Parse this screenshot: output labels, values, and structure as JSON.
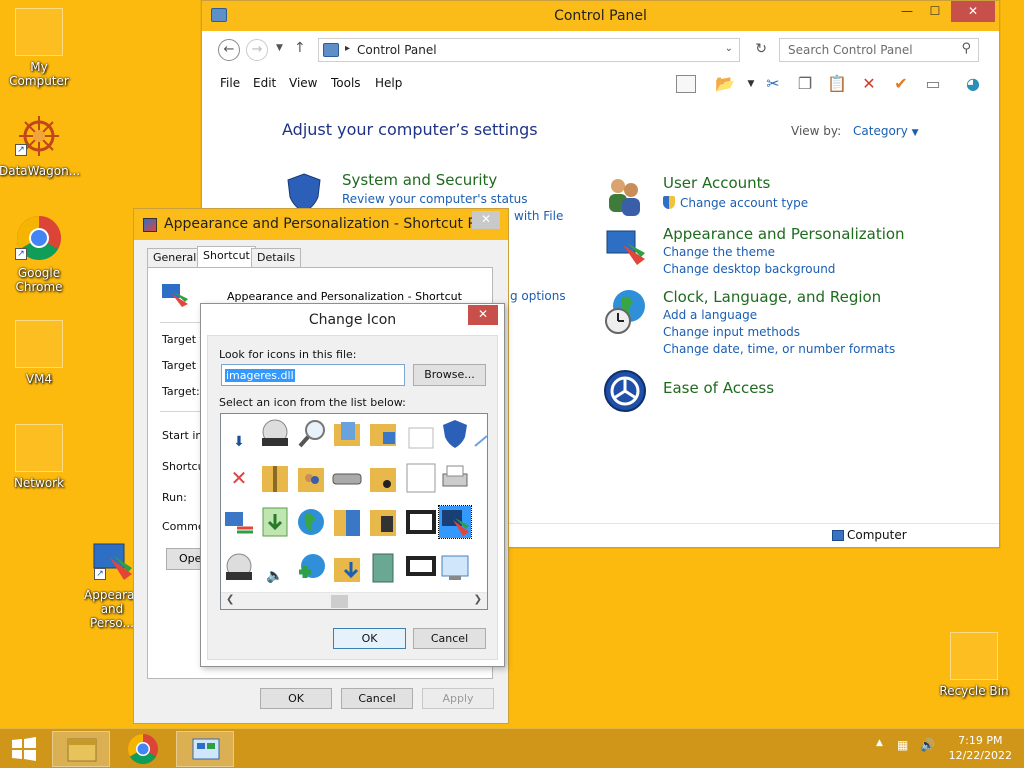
{
  "desktop": {
    "icons": [
      {
        "label": "My Computer"
      },
      {
        "label": "DataWagon..."
      },
      {
        "label": "Google Chrome"
      },
      {
        "label": "VM4"
      },
      {
        "label": "Network"
      },
      {
        "label": "Appearance and Perso..."
      },
      {
        "label": "Recycle Bin"
      }
    ]
  },
  "control_panel": {
    "title": "Control Panel",
    "address": "Control Panel",
    "search_placeholder": "Search Control Panel",
    "menu": [
      "File",
      "Edit",
      "View",
      "Tools",
      "Help"
    ],
    "heading": "Adjust your computer’s settings",
    "view_by_label": "View by:",
    "view_by_value": "Category",
    "groups": [
      {
        "title": "System and Security",
        "links": [
          "Review your computer's status"
        ]
      },
      {
        "title": "User Accounts",
        "links": [
          "Change account type"
        ]
      },
      {
        "title": "Appearance and Personalization",
        "links": [
          "Change the theme",
          "Change desktop background"
        ]
      },
      {
        "title": "Clock, Language, and Region",
        "links": [
          "Add a language",
          "Change input methods",
          "Change date, time, or number formats"
        ]
      },
      {
        "title": "Ease of Access",
        "links": []
      }
    ],
    "partial_links": [
      "with File",
      "g options"
    ],
    "status": "Computer"
  },
  "properties": {
    "title": "Appearance and Personalization - Shortcut P...",
    "tabs": [
      "General",
      "Shortcut",
      "Details"
    ],
    "name": "Appearance and Personalization - Shortcut",
    "fields": [
      "Target t",
      "Target lo",
      "Target:",
      "Start in:",
      "Shortcut",
      "Run:",
      "Commen"
    ],
    "open_button": "Ope",
    "ok": "OK",
    "cancel": "Cancel",
    "apply": "Apply"
  },
  "change_icon": {
    "title": "Change Icon",
    "look_label": "Look for icons in this file:",
    "file_value": "imageres.dll",
    "browse": "Browse...",
    "select_label": "Select an icon from the list below:",
    "ok": "OK",
    "cancel": "Cancel"
  },
  "taskbar": {
    "time": "7:19 PM",
    "date": "12/22/2022"
  },
  "colors": {
    "desktop": "#fcb90e",
    "accent_title": "#fbbb18",
    "link": "#1b5eb2",
    "group_title": "#1e6b1e"
  }
}
